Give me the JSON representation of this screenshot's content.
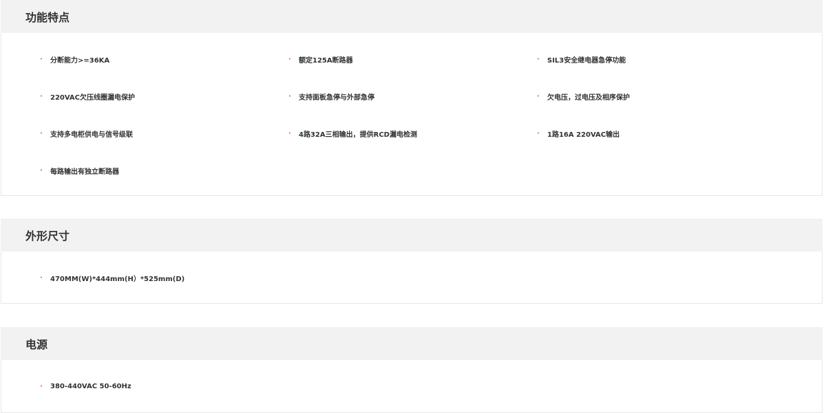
{
  "sections": [
    {
      "title": "功能特点",
      "items": [
        "分断能力>=36KA",
        "额定125A断路器",
        "SIL3安全继电器急停功能",
        "220VAC欠压线圈漏电保护",
        "支持面板急停与外部急停",
        "欠电压，过电压及相序保护",
        "支持多电柜供电与信号级联",
        "4路32A三相输出，提供RCD漏电检测",
        "1路16A 220VAC输出",
        "每路输出有独立断路器"
      ]
    },
    {
      "title": "外形尺寸",
      "items": [
        "470MM(W)*444mm(H）*525mm(D)"
      ]
    },
    {
      "title": "电源",
      "items": [
        "380-440VAC 50-60Hz"
      ]
    }
  ],
  "bullet_symbol": "·",
  "colors": {
    "bullet": "#e8632b",
    "header_bg": "#f2f2f2",
    "border": "#e6e6e6",
    "text": "#333333"
  }
}
